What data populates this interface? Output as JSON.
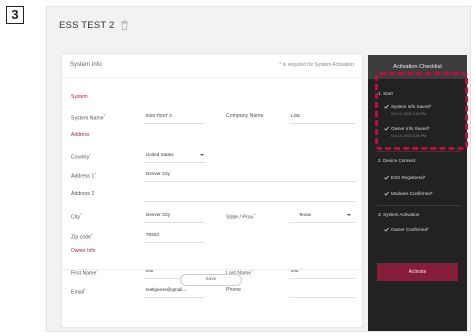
{
  "step_number": "3",
  "page": {
    "title": "ESS TEST 2"
  },
  "system_info": {
    "card_title": "System Info",
    "required_note": "* is required for System Activation",
    "sections": {
      "system": "System",
      "address": "Address",
      "owner_info": "Owner Info"
    },
    "fields": {
      "system_name": {
        "label": "System Name",
        "value": "ESS TEST 2"
      },
      "company_name": {
        "label": "Company Name",
        "value": "LGE"
      },
      "country": {
        "label": "Country",
        "value": "United States"
      },
      "address1": {
        "label": "Address 1",
        "value": "Denver City"
      },
      "address2": {
        "label": "Address 2",
        "value": ""
      },
      "city": {
        "label": "City",
        "value": "Denver City"
      },
      "state": {
        "label": "State / Prov.",
        "value": "Texas"
      },
      "zip": {
        "label": "Zip code",
        "value": "79323"
      },
      "first_name": {
        "label": "First Name",
        "value": "test"
      },
      "last_name": {
        "label": "Last Name",
        "value": "test"
      },
      "email": {
        "label": "Email",
        "value": "testlgeess@gmail..."
      },
      "phone": {
        "label": "Phone",
        "value": ""
      }
    },
    "save_label": "Save"
  },
  "checklist": {
    "title": "Activation Checklist",
    "steps": [
      {
        "label": "1. Start",
        "items": [
          {
            "label": "System Info Saved*",
            "timestamp": "Oct 14, 2022 4:44 PM"
          },
          {
            "label": "Owner Info Saved*",
            "timestamp": "Oct 14, 2022 4:44 PM"
          }
        ]
      },
      {
        "label": "2. Device Connect",
        "items": [
          {
            "label": "ESS Registered*"
          },
          {
            "label": "Modules Confirmed*"
          }
        ]
      },
      {
        "label": "3. System Activation",
        "items": [
          {
            "label": "Owner Confirmed*"
          }
        ]
      }
    ],
    "activate_label": "Activate"
  },
  "colors": {
    "accent": "#b0243a",
    "activate": "#861d3b",
    "highlight": "#b80f3c",
    "panel": "#222222"
  }
}
